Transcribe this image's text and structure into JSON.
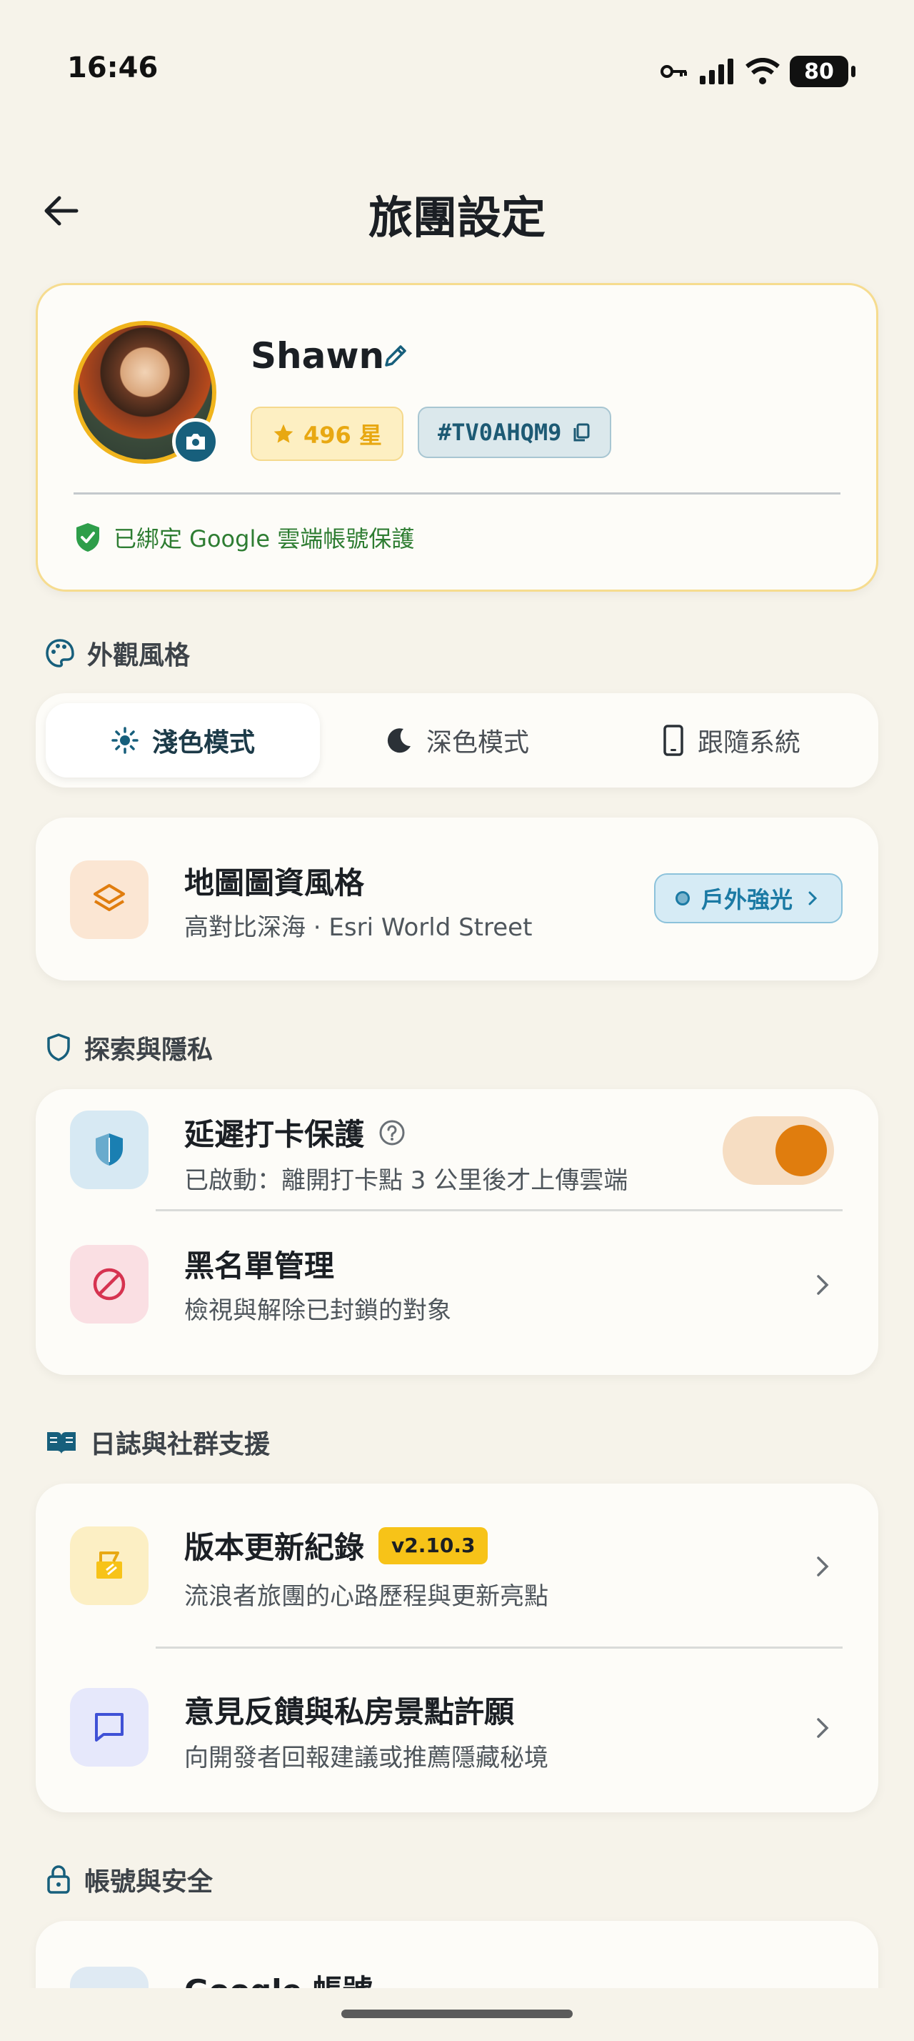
{
  "status_bar": {
    "time": "16:46",
    "battery": "80"
  },
  "header": {
    "title": "旅團設定"
  },
  "profile": {
    "name": "Shawn",
    "stars": "496 星",
    "user_id": "#TV0AHQM9",
    "google_status": "已綁定 Google 雲端帳號保護"
  },
  "appearance": {
    "section_title": "外觀風格",
    "modes": [
      {
        "label": "淺色模式",
        "icon": "sun-icon",
        "active": true
      },
      {
        "label": "深色模式",
        "icon": "moon-icon",
        "active": false
      },
      {
        "label": "跟隨系統",
        "icon": "phone-icon",
        "active": false
      }
    ],
    "map": {
      "title": "地圖圖資風格",
      "subtitle": "高對比深海 · Esri World Street",
      "pill": "戶外強光"
    }
  },
  "privacy": {
    "section_title": "探索與隱私",
    "delay": {
      "title": "延遲打卡保護",
      "subtitle": "已啟動：離開打卡點 3 公里後才上傳雲端",
      "enabled": true
    },
    "blacklist": {
      "title": "黑名單管理",
      "subtitle": "檢視與解除已封鎖的對象"
    }
  },
  "support": {
    "section_title": "日誌與社群支援",
    "changelog": {
      "title": "版本更新紀錄",
      "version": "v2.10.3",
      "subtitle": "流浪者旅團的心路歷程與更新亮點"
    },
    "feedback": {
      "title": "意見反饋與私房景點許願",
      "subtitle": "向開發者回報建議或推薦隱藏秘境"
    }
  },
  "account": {
    "section_title": "帳號與安全",
    "google": {
      "title": "Google 帳號"
    }
  },
  "colors": {
    "background": "#f6f3ea",
    "accent_teal": "#175f7c",
    "accent_orange": "#e07d0e",
    "gold": "#f0b41c",
    "success_green": "#2e7d32"
  }
}
